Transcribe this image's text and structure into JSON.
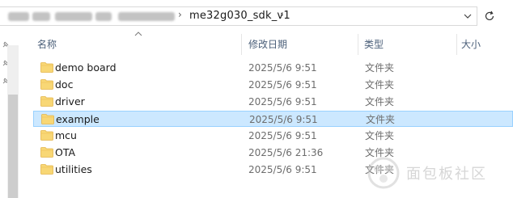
{
  "address_bar": {
    "current_folder": "me32g030_sdk_v1",
    "separator": "›"
  },
  "columns": {
    "name": "名称",
    "date": "修改日期",
    "type": "类型",
    "size": "大小"
  },
  "files": [
    {
      "name": "demo board",
      "date": "2025/5/6 9:51",
      "type": "文件夹",
      "icon": "folder-icon",
      "selected": false
    },
    {
      "name": "doc",
      "date": "2025/5/6 9:51",
      "type": "文件夹",
      "icon": "folder-icon",
      "selected": false
    },
    {
      "name": "driver",
      "date": "2025/5/6 9:51",
      "type": "文件夹",
      "icon": "folder-icon",
      "selected": false
    },
    {
      "name": "example",
      "date": "2025/5/6 9:51",
      "type": "文件夹",
      "icon": "folder-icon",
      "selected": true
    },
    {
      "name": "mcu",
      "date": "2025/5/6 9:51",
      "type": "文件夹",
      "icon": "folder-icon",
      "selected": false
    },
    {
      "name": "OTA",
      "date": "2025/5/6 21:36",
      "type": "文件夹",
      "icon": "folder-icon",
      "selected": false
    },
    {
      "name": "utilities",
      "date": "2025/5/6 9:51",
      "type": "文件夹",
      "icon": "folder-icon",
      "selected": false
    }
  ],
  "watermark": {
    "text": "面包板社区"
  },
  "colors": {
    "selection_bg": "#cce8ff",
    "selection_border": "#99d1ff",
    "folder_yellow": "#f8d775",
    "header_text": "#4c607a"
  }
}
